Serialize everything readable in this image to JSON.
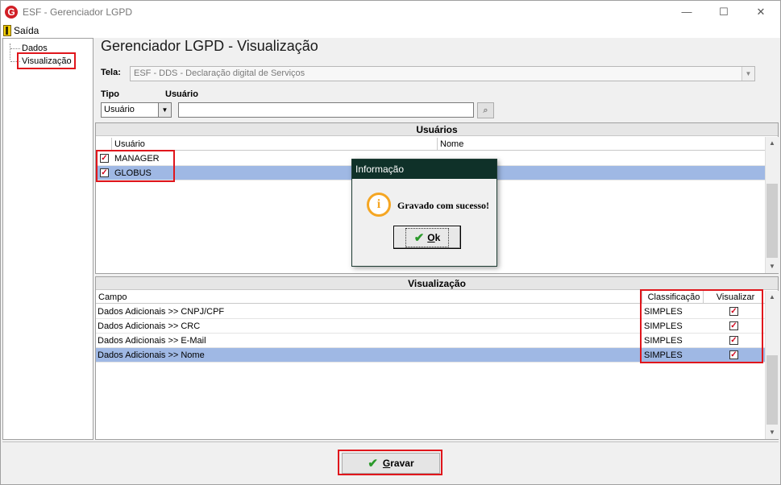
{
  "window": {
    "title": "ESF - Gerenciador LGPD",
    "logo_letter": "G",
    "controls": {
      "minimize": "—",
      "maximize": "☐",
      "close": "✕"
    }
  },
  "menu": {
    "exit_label": "Saída"
  },
  "tree": {
    "items": [
      "Dados",
      "Visualização"
    ]
  },
  "main": {
    "title": "Gerenciador LGPD - Visualização",
    "tela_label": "Tela:",
    "tela_value": "ESF - DDS - Declaração digital de Serviços",
    "tipo_label": "Tipo",
    "usuario_label": "Usuário",
    "tipo_value": "Usuário",
    "usuario_value": ""
  },
  "usuarios": {
    "header": "Usuários",
    "columns": [
      "Usuário",
      "Nome"
    ],
    "rows": [
      {
        "usuario": "MANAGER",
        "nome": "",
        "checked": true,
        "selected": false
      },
      {
        "usuario": "GLOBUS",
        "nome": "",
        "checked": true,
        "selected": true
      }
    ]
  },
  "visualizacao": {
    "header": "Visualização",
    "columns": [
      "Campo",
      "Classificação",
      "Visualizar"
    ],
    "rows": [
      {
        "campo": "Dados Adicionais >> CNPJ/CPF",
        "classificacao": "SIMPLES",
        "visualizar": true,
        "selected": false
      },
      {
        "campo": "Dados Adicionais >> CRC",
        "classificacao": "SIMPLES",
        "visualizar": true,
        "selected": false
      },
      {
        "campo": "Dados Adicionais >> E-Mail",
        "classificacao": "SIMPLES",
        "visualizar": true,
        "selected": false
      },
      {
        "campo": "Dados Adicionais >> Nome",
        "classificacao": "SIMPLES",
        "visualizar": true,
        "selected": true
      }
    ]
  },
  "dialog": {
    "title": "Informação",
    "message": "Gravado com sucesso!",
    "ok_label": "Ok"
  },
  "footer": {
    "save_label": "Gravar"
  },
  "colors": {
    "highlight": "#e0161c",
    "selection": "#9fb8e4",
    "dialog_title": "#0f3129"
  }
}
